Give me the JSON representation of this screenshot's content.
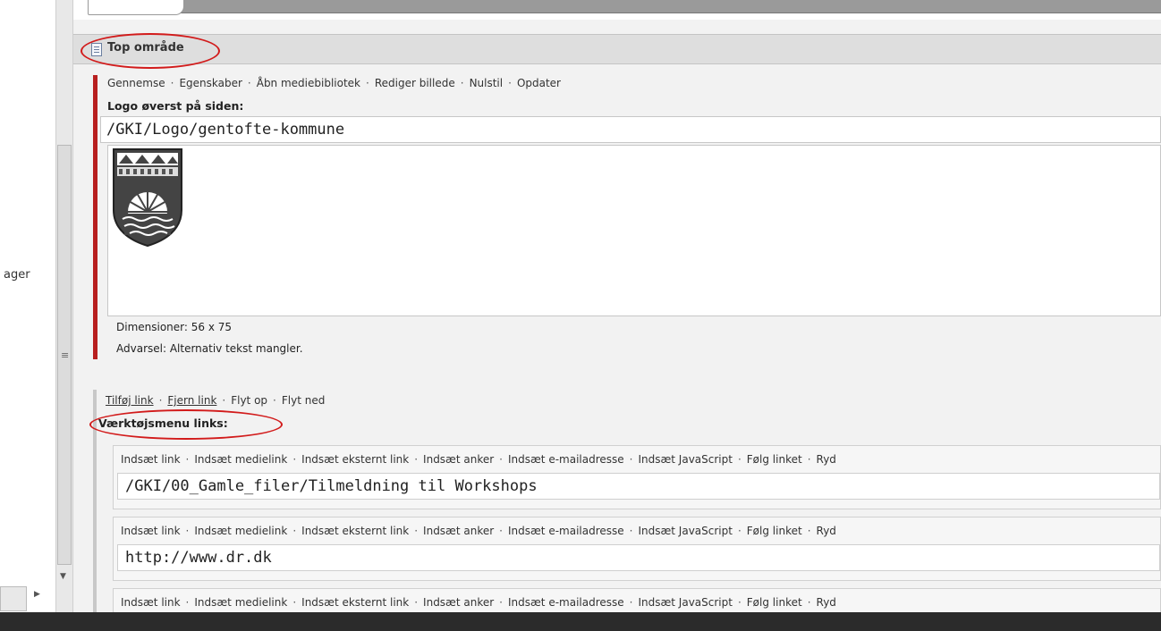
{
  "left": {
    "label": "ager"
  },
  "section": {
    "title": "Top område"
  },
  "image_field": {
    "toolbar": [
      "Gennemse",
      "Egenskaber",
      "Åbn mediebibliotek",
      "Rediger billede",
      "Nulstil",
      "Opdater"
    ],
    "label": "Logo øverst på siden:",
    "path": "/GKI/Logo/gentofte-kommune",
    "dimensions": "Dimensioner: 56 x 75",
    "warning": "Advarsel: Alternativ tekst mangler."
  },
  "links_field": {
    "toolbar": [
      "Tilføj link",
      "Fjern link",
      "Flyt op",
      "Flyt ned"
    ],
    "label": "Værktøjsmenu links:",
    "items": [
      {
        "toolbar": [
          "Indsæt link",
          "Indsæt medielink",
          "Indsæt eksternt link",
          "Indsæt anker",
          "Indsæt e-mailadresse",
          "Indsæt JavaScript",
          "Følg linket",
          "Ryd"
        ],
        "value": "/GKI/00_Gamle_filer/Tilmeldning til Workshops"
      },
      {
        "toolbar": [
          "Indsæt link",
          "Indsæt medielink",
          "Indsæt eksternt link",
          "Indsæt anker",
          "Indsæt e-mailadresse",
          "Indsæt JavaScript",
          "Følg linket",
          "Ryd"
        ],
        "value": "http://www.dr.dk"
      },
      {
        "toolbar": [
          "Indsæt link",
          "Indsæt medielink",
          "Indsæt eksternt link",
          "Indsæt anker",
          "Indsæt e-mailadresse",
          "Indsæt JavaScript",
          "Følg linket",
          "Ryd"
        ],
        "value": ""
      }
    ]
  },
  "colors": {
    "annotation": "#d21b1b",
    "field_rule": "#b81f1f",
    "taskbar": "#2b2b2b"
  },
  "icons": {
    "section": "document-icon",
    "scroll_grip": "grip-icon",
    "scroll_down": "arrow-down-icon",
    "scroll_right": "arrow-right-icon"
  }
}
